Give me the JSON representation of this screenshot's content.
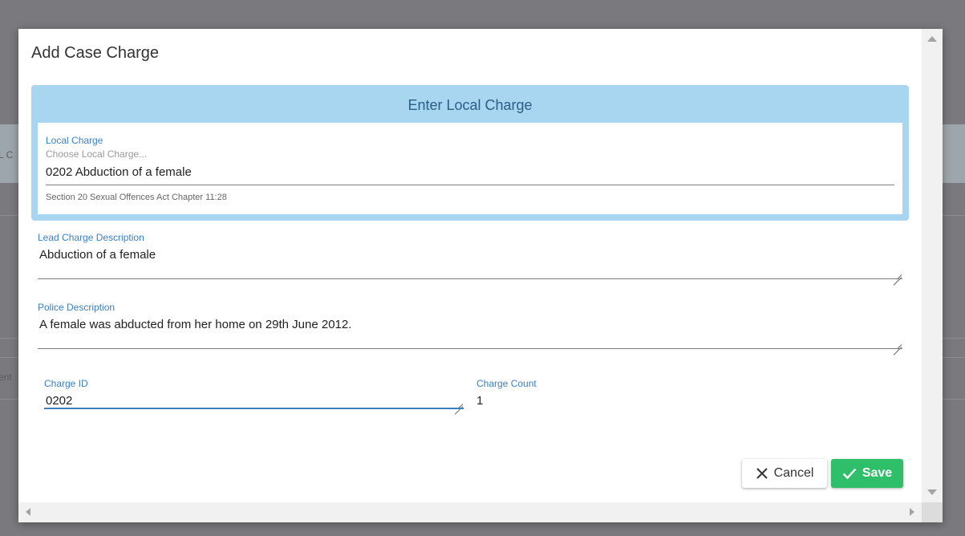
{
  "background": {
    "fragment_left_top": "L C",
    "fragment_left_bottom": "ent"
  },
  "modal": {
    "title": "Add Case Charge"
  },
  "local_charge_panel": {
    "heading": "Enter Local Charge",
    "field_label": "Local Charge",
    "placeholder": "Choose Local Charge...",
    "value": "0202 Abduction of a female",
    "hint": "Section 20 Sexual Offences Act Chapter 11:28"
  },
  "lead_charge_description": {
    "label": "Lead Charge Description",
    "value": "Abduction of a female"
  },
  "police_description": {
    "label": "Police Description",
    "value": "A female was abducted from her home on 29th June 2012."
  },
  "charge_id": {
    "label": "Charge ID",
    "value": "0202"
  },
  "charge_count": {
    "label": "Charge Count",
    "value": "1"
  },
  "actions": {
    "cancel_label": "Cancel",
    "save_label": "Save"
  },
  "icons": {
    "cancel": "close-icon",
    "save": "check-icon"
  },
  "colors": {
    "panel": "#a8d5f0",
    "accent": "#3a7fc0",
    "save": "#2fbe6a"
  }
}
